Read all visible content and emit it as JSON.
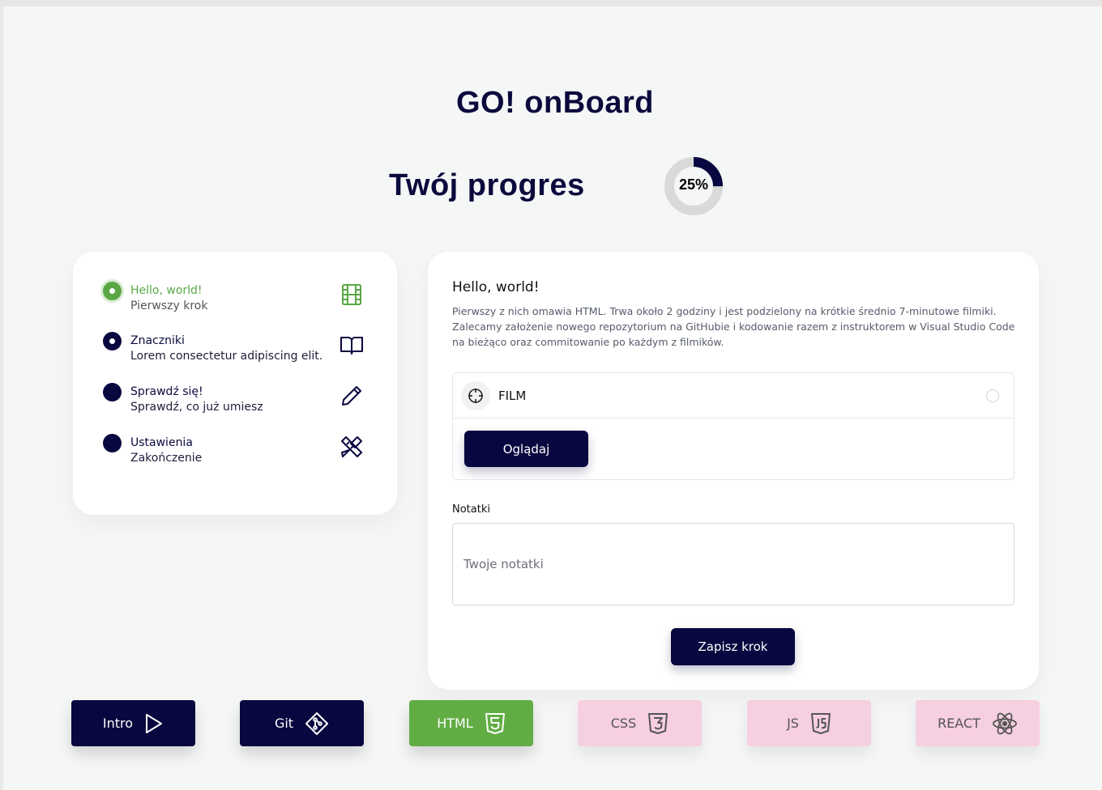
{
  "colors": {
    "navy": "#08073f",
    "green": "#5aa845",
    "pink": "#f6cfe0",
    "background": "#f5f7f7"
  },
  "header": {
    "title": "GO! onBoard",
    "progress_title": "Twój progres",
    "progress_label": "25%",
    "progress_value": 0.25
  },
  "steps": [
    {
      "title": "Hello, world!",
      "subtitle": "Pierwszy krok",
      "icon": "film-icon",
      "state": "active"
    },
    {
      "title": "Znaczniki",
      "subtitle": "Lorem consectetur adipiscing elit.",
      "icon": "book-icon",
      "state": "current"
    },
    {
      "title": "Sprawdź się!",
      "subtitle": "Sprawdź, co już umiesz",
      "icon": "pencil-icon",
      "state": "locked"
    },
    {
      "title": "Ustawienia",
      "subtitle": "Zakończenie",
      "icon": "tools-icon",
      "state": "locked"
    }
  ],
  "main": {
    "heading": "Hello, world!",
    "description": "Pierwszy z nich omawia HTML. Trwa około 2 godziny i jest podzielony na krótkie średnio 7-minutowe filmiki. Zalecamy założenie nowego repozytorium na GitHubie i kodowanie razem z instruktorem w Visual Studio Code na bieżąco oraz commitowanie po każdym z filmików.",
    "film_label": "FILM",
    "watch_button": "Oglądaj",
    "notes_label": "Notatki",
    "notes_placeholder": "Twoje notatki",
    "notes_value": "",
    "save_button": "Zapisz krok"
  },
  "tech_buttons": [
    {
      "label": "Intro",
      "icon": "play-icon",
      "style": "dark"
    },
    {
      "label": "Git",
      "icon": "git-icon",
      "style": "dark"
    },
    {
      "label": "HTML",
      "icon": "html5-icon",
      "style": "green"
    },
    {
      "label": "CSS",
      "icon": "css3-icon",
      "style": "pink"
    },
    {
      "label": "JS",
      "icon": "js-icon",
      "style": "pink"
    },
    {
      "label": "REACT",
      "icon": "react-icon",
      "style": "pink"
    }
  ]
}
